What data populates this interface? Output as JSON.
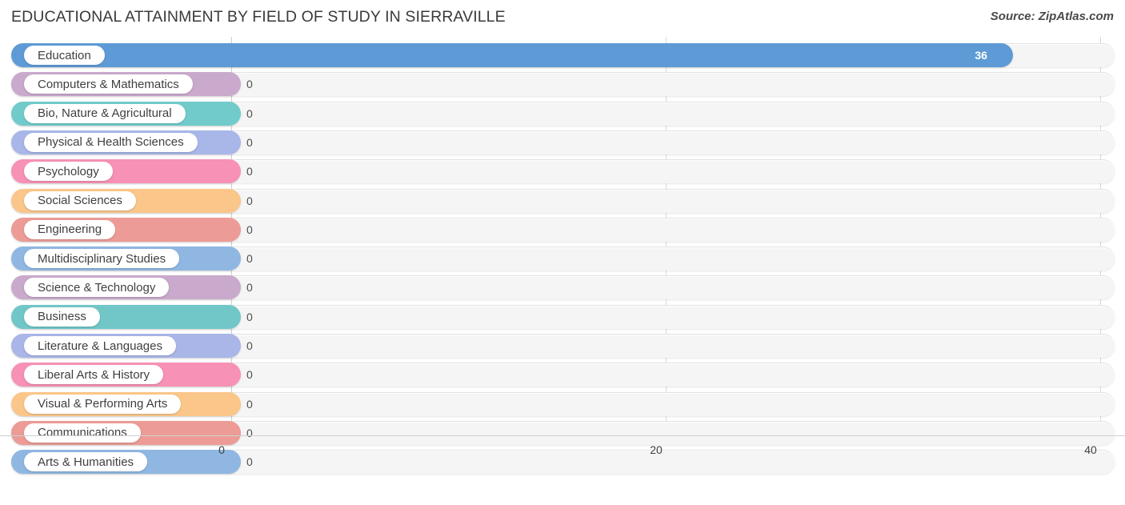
{
  "header": {
    "title": "EDUCATIONAL ATTAINMENT BY FIELD OF STUDY IN SIERRAVILLE",
    "source": "Source: ZipAtlas.com"
  },
  "chart_data": {
    "type": "bar",
    "orientation": "horizontal",
    "title": "EDUCATIONAL ATTAINMENT BY FIELD OF STUDY IN SIERRAVILLE",
    "xlabel": "",
    "ylabel": "",
    "xlim": [
      0,
      40
    ],
    "xticks": [
      0,
      20,
      40
    ],
    "xtick_labels": [
      "0",
      "20",
      "40"
    ],
    "grid": true,
    "legend": false,
    "categories": [
      "Education",
      "Computers & Mathematics",
      "Bio, Nature & Agricultural",
      "Physical & Health Sciences",
      "Psychology",
      "Social Sciences",
      "Engineering",
      "Multidisciplinary Studies",
      "Science & Technology",
      "Business",
      "Literature & Languages",
      "Liberal Arts & History",
      "Visual & Performing Arts",
      "Communications",
      "Arts & Humanities"
    ],
    "values": [
      36,
      0,
      0,
      0,
      0,
      0,
      0,
      0,
      0,
      0,
      0,
      0,
      0,
      0,
      0
    ],
    "value_labels": [
      "36",
      "0",
      "0",
      "0",
      "0",
      "0",
      "0",
      "0",
      "0",
      "0",
      "0",
      "0",
      "0",
      "0",
      "0"
    ],
    "colors": [
      "#5e9bd6",
      "#c9a9cc",
      "#71cbcb",
      "#a8b6e8",
      "#f791b6",
      "#fbc68a",
      "#ec9b96",
      "#8fb7e2",
      "#c9a9cc",
      "#71c6c8",
      "#aab6e8",
      "#f791b6",
      "#fbc68a",
      "#ec9b96",
      "#8fb7e2"
    ]
  },
  "axis": {
    "ticks": [
      {
        "label": "0",
        "value": 0
      },
      {
        "label": "20",
        "value": 20
      },
      {
        "label": "40",
        "value": 40
      }
    ]
  }
}
